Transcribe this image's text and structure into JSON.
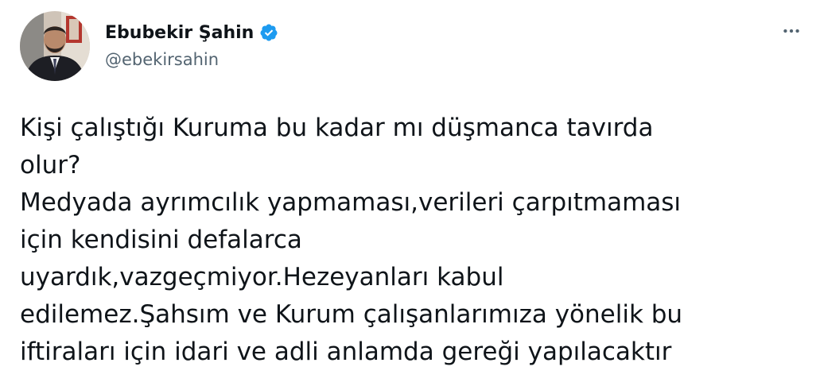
{
  "author": {
    "display_name": "Ebubekir Şahin",
    "handle": "@ebekirsahin",
    "verified": true,
    "avatar_icon": "profile-photo",
    "verified_icon": "verified-badge-icon",
    "verified_color": "#1d9bf0"
  },
  "menu": {
    "more_icon": "more-horizontal-icon",
    "more_color": "#536471"
  },
  "tweet": {
    "lines": [
      "Kişi çalıştığı Kuruma bu kadar mı düşmanca tavırda",
      "olur?",
      "Medyada ayrımcılık yapmaması,verileri çarpıtmaması",
      "için kendisini defalarca",
      "uyardık,vazgeçmiyor.Hezeyanları kabul",
      "edilemez.Şahsım ve Kurum çalışanlarımıza yönelik bu",
      "iftiraları için idari ve adli anlamda gereği yapılacaktır"
    ]
  },
  "colors": {
    "text_primary": "#0f1419",
    "text_secondary": "#536471",
    "background": "#ffffff"
  }
}
